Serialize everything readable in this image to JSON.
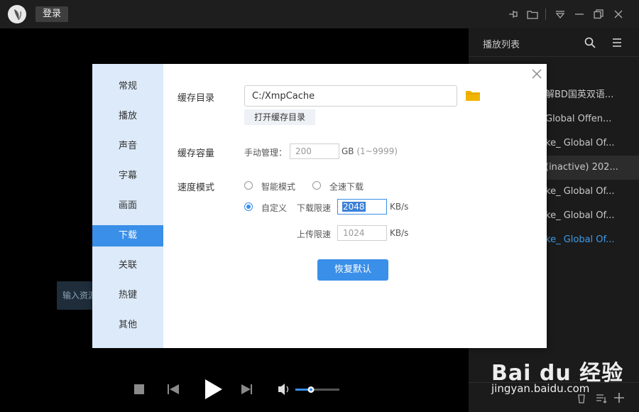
{
  "topbar": {
    "login_label": "登录",
    "icons": [
      "logo-icon",
      "pin-icon",
      "folder-icon",
      "menu-down-icon",
      "minimize-icon",
      "restore-icon",
      "close-icon"
    ]
  },
  "video": {
    "input_resource_placeholder": "输入资源"
  },
  "playlist": {
    "title": "播放列表",
    "items": [
      {
        "label": "解BD国英双语..."
      },
      {
        "label": "Global Offen..."
      },
      {
        "label": "ke_ Global Of..."
      },
      {
        "label": "(inactive) 202..."
      },
      {
        "label": "ke_ Global Of..."
      },
      {
        "label": "ke_ Global Of..."
      },
      {
        "label": "ke_ Global Of..."
      }
    ]
  },
  "watermark": {
    "main": "Bai du 经验",
    "sub": "jingyan.baidu.com"
  },
  "dialog": {
    "nav": [
      "常规",
      "播放",
      "声音",
      "字幕",
      "画面",
      "下载",
      "关联",
      "热键",
      "其他"
    ],
    "active_nav": "下载",
    "cache_dir": {
      "label": "缓存目录",
      "value": "C:/XmpCache",
      "open_button": "打开缓存目录"
    },
    "cache_size": {
      "label": "缓存容量",
      "manual_label": "手动管理：",
      "value": "200",
      "unit": "GB",
      "range": "(1~9999)"
    },
    "speed_mode": {
      "label": "速度模式",
      "smart": "智能模式",
      "full": "全速下载",
      "custom": "自定义",
      "selected": "自定义",
      "download_limit_label": "下载限速",
      "download_limit_value": "2048",
      "upload_limit_label": "上传限速",
      "upload_limit_value": "1024",
      "unit": "KB/s"
    },
    "restore_button": "恢复默认"
  },
  "colors": {
    "accent": "#3a8fe8",
    "nav_bg": "#dceaf9",
    "playlist_active": "#3e9be8"
  }
}
